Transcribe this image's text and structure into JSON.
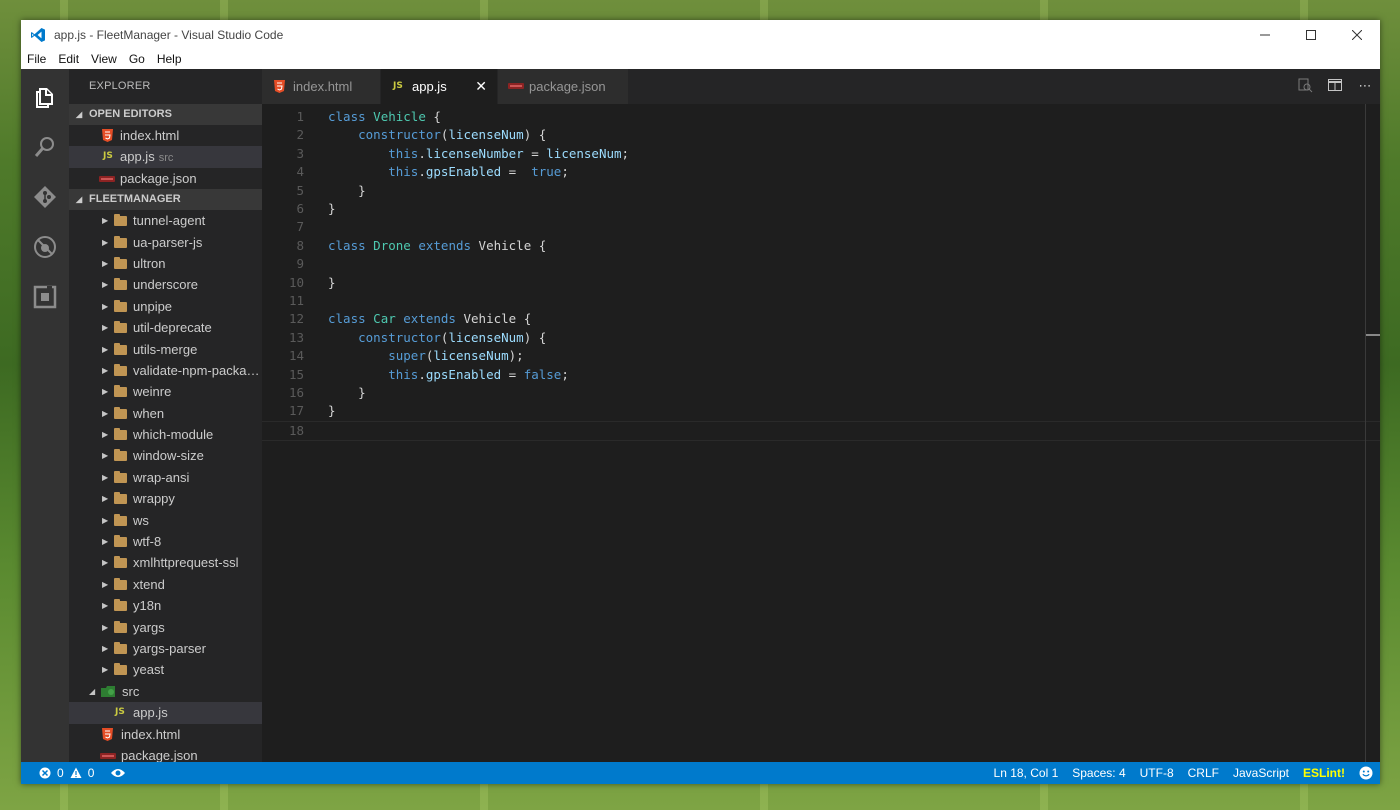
{
  "window": {
    "title": "app.js - FleetManager - Visual Studio Code"
  },
  "menu": [
    "File",
    "Edit",
    "View",
    "Go",
    "Help"
  ],
  "activity_bar": [
    "files-icon",
    "search-icon",
    "git-icon",
    "debug-icon",
    "extensions-icon"
  ],
  "sidebar": {
    "title": "EXPLORER",
    "open_editors_label": "OPEN EDITORS",
    "open_editors": [
      {
        "name": "index.html",
        "type": "html"
      },
      {
        "name": "app.js",
        "detail": "src",
        "type": "js"
      },
      {
        "name": "package.json",
        "type": "json"
      }
    ],
    "project_label": "FLEETMANAGER",
    "folders": [
      "tunnel-agent",
      "ua-parser-js",
      "ultron",
      "underscore",
      "unpipe",
      "util-deprecate",
      "utils-merge",
      "validate-npm-packag...",
      "weinre",
      "when",
      "which-module",
      "window-size",
      "wrap-ansi",
      "wrappy",
      "ws",
      "wtf-8",
      "xmlhttprequest-ssl",
      "xtend",
      "y18n",
      "yargs",
      "yargs-parser",
      "yeast"
    ],
    "src_folder": "src",
    "src_files": [
      "app.js"
    ],
    "root_files": [
      "index.html",
      "package.json"
    ]
  },
  "tabs": [
    {
      "label": "index.html",
      "type": "html",
      "active": false
    },
    {
      "label": "app.js",
      "type": "js",
      "active": true
    },
    {
      "label": "package.json",
      "type": "json",
      "active": false
    }
  ],
  "editor": {
    "line_count": 18,
    "lines": [
      "class Vehicle {",
      "    constructor(licenseNum) {",
      "        this.licenseNumber = licenseNum;",
      "        this.gpsEnabled =  true;",
      "    }",
      "}",
      "",
      "class Drone extends Vehicle {",
      "",
      "}",
      "",
      "class Car extends Vehicle {",
      "    constructor(licenseNum) {",
      "        super(licenseNum);",
      "        this.gpsEnabled = false;",
      "    }",
      "}",
      ""
    ]
  },
  "status": {
    "errors": "0",
    "warnings": "0",
    "position": "Ln 18, Col 1",
    "spaces": "Spaces: 4",
    "encoding": "UTF-8",
    "eol": "CRLF",
    "language": "JavaScript",
    "linter": "ESLint!"
  },
  "colors": {
    "keyword": "#569cd6",
    "class_name": "#4ec9b0",
    "identifier": "#9cdcfe",
    "status_bar": "#007acc"
  }
}
